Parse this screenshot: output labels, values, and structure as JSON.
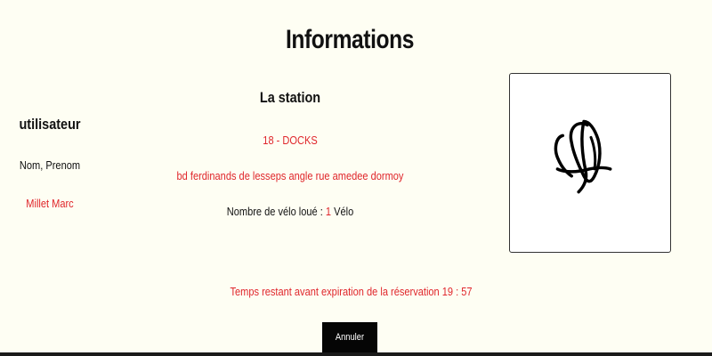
{
  "page": {
    "title": "Informations"
  },
  "user": {
    "heading": "utilisateur",
    "field_label": "Nom, Prenom",
    "name": "Millet Marc"
  },
  "station": {
    "heading": "La station",
    "id": "18 - DOCKS",
    "address": "bd ferdinands de lesseps angle rue amedee dormoy",
    "bike_label": "Nombre de vélo loué : ",
    "bike_count": "1",
    "bike_unit": " Vélo"
  },
  "signature": {
    "icon": "signature-drawing"
  },
  "reservation": {
    "timer_text": "Temps restant avant expiration de la réservation 19 : 57"
  },
  "actions": {
    "cancel_label": "Annuler"
  },
  "colors": {
    "background": "#fefef3",
    "accent_red": "#e0262b",
    "button_bg": "#050505"
  }
}
